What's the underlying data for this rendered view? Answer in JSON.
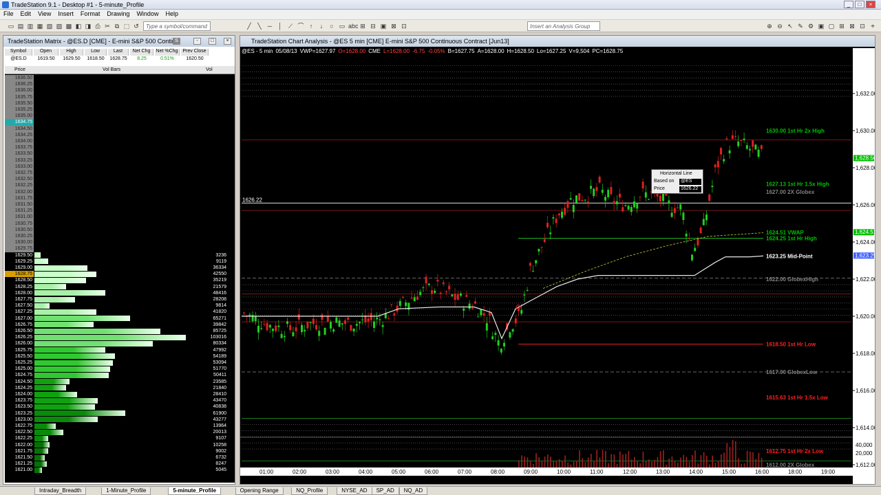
{
  "window": {
    "title": "TradeStation 9.1 - Desktop #1 - 5-minute_Profile"
  },
  "menu": [
    "File",
    "Edit",
    "View",
    "Insert",
    "Format",
    "Drawing",
    "Window",
    "Help"
  ],
  "toolbar": {
    "symbol_placeholder": "Type a symbol/command",
    "analysis_placeholder": "Insert an Analysis Group"
  },
  "matrix": {
    "title": "TradeStation Matrix - @ES.D [CME] - E-mini S&P 500 Contin...",
    "quote_headers": [
      "Symbol",
      "Open",
      "High",
      "Low",
      "Last",
      "Net Chg",
      "Net %Chg",
      "Prev Close"
    ],
    "quote_values": [
      "@ES.D",
      "1619.50",
      "1629.50",
      "1618.50",
      "1628.75",
      "8.25",
      "0.51%",
      "1620.50"
    ],
    "ladder_headers": {
      "price": "Price",
      "bars": "Vol Bars",
      "vol": "Vol"
    },
    "empty_prices": [
      "1636.50",
      "1636.25",
      "1636.00",
      "1635.75",
      "1635.50",
      "1635.25",
      "1635.00",
      "1634.75",
      "1634.50",
      "1634.25",
      "1634.00",
      "1633.75",
      "1633.50",
      "1633.25",
      "1633.00",
      "1632.75",
      "1632.50",
      "1632.25",
      "1632.00",
      "1631.75",
      "1631.50",
      "1631.25",
      "1631.00",
      "1630.75",
      "1630.50",
      "1630.25",
      "1630.00",
      "1629.75"
    ],
    "rows": [
      {
        "price": "1629.50",
        "vol": "3236",
        "vb": 0.04
      },
      {
        "price": "1629.25",
        "vol": "9119",
        "vb": 0.09
      },
      {
        "price": "1629.00",
        "vol": "36334",
        "vb": 0.35
      },
      {
        "price": "1628.75",
        "vol": "42550",
        "vb": 0.41,
        "last": true
      },
      {
        "price": "1628.50",
        "vol": "35219",
        "vb": 0.34
      },
      {
        "price": "1628.25",
        "vol": "21579",
        "vb": 0.21
      },
      {
        "price": "1628.00",
        "vol": "48416",
        "vb": 0.47
      },
      {
        "price": "1627.75",
        "vol": "28208",
        "vb": 0.27
      },
      {
        "price": "1627.50",
        "vol": "9814",
        "vb": 0.1
      },
      {
        "price": "1627.25",
        "vol": "41820",
        "vb": 0.41
      },
      {
        "price": "1627.00",
        "vol": "65271",
        "vb": 0.63
      },
      {
        "price": "1626.75",
        "vol": "39842",
        "vb": 0.39
      },
      {
        "price": "1626.50",
        "vol": "85725",
        "vb": 0.83
      },
      {
        "price": "1626.25",
        "vol": "103016",
        "vb": 1.0
      },
      {
        "price": "1626.00",
        "vol": "80334",
        "vb": 0.78
      },
      {
        "price": "1625.75",
        "vol": "47992",
        "vb": 0.47
      },
      {
        "price": "1625.50",
        "vol": "54189",
        "vb": 0.53
      },
      {
        "price": "1625.25",
        "vol": "53094",
        "vb": 0.52
      },
      {
        "price": "1625.00",
        "vol": "51770",
        "vb": 0.5
      },
      {
        "price": "1624.75",
        "vol": "50411",
        "vb": 0.49
      },
      {
        "price": "1624.50",
        "vol": "23585",
        "vb": 0.23
      },
      {
        "price": "1624.25",
        "vol": "21840",
        "vb": 0.21
      },
      {
        "price": "1624.00",
        "vol": "28410",
        "vb": 0.28
      },
      {
        "price": "1623.75",
        "vol": "43470",
        "vb": 0.42
      },
      {
        "price": "1623.50",
        "vol": "40838",
        "vb": 0.4
      },
      {
        "price": "1623.25",
        "vol": "61900",
        "vb": 0.6
      },
      {
        "price": "1623.00",
        "vol": "43277",
        "vb": 0.42
      },
      {
        "price": "1622.75",
        "vol": "13964",
        "vb": 0.14
      },
      {
        "price": "1622.50",
        "vol": "20013",
        "vb": 0.19
      },
      {
        "price": "1622.25",
        "vol": "9107",
        "vb": 0.09
      },
      {
        "price": "1622.00",
        "vol": "10258",
        "vb": 0.1
      },
      {
        "price": "1621.75",
        "vol": "9002",
        "vb": 0.09
      },
      {
        "price": "1621.50",
        "vol": "6732",
        "vb": 0.07
      },
      {
        "price": "1621.25",
        "vol": "8247",
        "vb": 0.08
      },
      {
        "price": "1621.00",
        "vol": "5045",
        "vb": 0.05
      }
    ]
  },
  "chart": {
    "title": "TradeStation Chart Analysis - @ES 5 min [CME] E-mini S&P 500 Continuous Contract [Jun13]",
    "info": [
      "@ES - 5 min",
      "05/08/13",
      "VWP=1627.97",
      "O=1628.00",
      "CME",
      "L=1628.00",
      "-6.75",
      "-0.05%",
      "B=1627.75",
      "A=1628.00",
      "H=1628.50",
      "Lo=1627.25",
      "V=9,504",
      "PC=1628.75"
    ],
    "hline_label": "1626.22",
    "price_labels": [
      "1,632.00",
      "1,630.00",
      "1,628.00",
      "1,626.00",
      "1,624.00",
      "1,622.00",
      "1,620.00",
      "1,618.00",
      "1,616.00",
      "1,614.00",
      "1,612.00"
    ],
    "price_ticks": [
      1632,
      1630,
      1628,
      1626,
      1624,
      1622,
      1620,
      1618,
      1616,
      1614,
      1612
    ],
    "vol_labels": [
      "40,000",
      "20,000"
    ],
    "time_labels": [
      "01:00",
      "02:00",
      "03:00",
      "04:00",
      "05:00",
      "06:00",
      "07:00",
      "08:00",
      "09:00",
      "10:00",
      "11:00",
      "12:00",
      "13:00",
      "14:00",
      "15:00",
      "16:00",
      "18:00",
      "19:00"
    ],
    "right_tags": [
      {
        "text": "1,628.50",
        "price": 1628.5,
        "color": "#00c000"
      },
      {
        "text": "1,624.51",
        "price": 1624.51,
        "color": "#00c000"
      },
      {
        "text": "1,623.25",
        "price": 1623.25,
        "color": "#4060ff"
      }
    ],
    "levels": [
      {
        "text": "1630.00 1st Hr  2x High",
        "price": 1630.0,
        "color": "#00c000"
      },
      {
        "text": "1627.13 1st Hr  1.5x High",
        "price": 1627.13,
        "color": "#00c000"
      },
      {
        "text": "1627.00 2X Globex",
        "price": 1626.7,
        "color": "#808080"
      },
      {
        "text": "1624.51 VWAP",
        "price": 1624.51,
        "color": "#00c000"
      },
      {
        "text": "1624.25 1st Hr  High",
        "price": 1624.2,
        "color": "#00c000"
      },
      {
        "text": "1623.25 Mid-Point",
        "price": 1623.25,
        "color": "#ffffff"
      },
      {
        "text": "1622.00 GlobexHigh",
        "price": 1622.0,
        "color": "#808080"
      },
      {
        "text": "1618.50 1st Hr  Low",
        "price": 1618.5,
        "color": "#ff2020"
      },
      {
        "text": "1617.00 GlobexLow",
        "price": 1617.0,
        "color": "#808080"
      },
      {
        "text": "1615.63 1st Hr  1.5x Low",
        "price": 1615.63,
        "color": "#ff2020"
      },
      {
        "text": "1612.75 1st Hr  2x Low",
        "price": 1612.75,
        "color": "#ff2020"
      },
      {
        "text": "1612.00 2X Globex",
        "price": 1612.0,
        "color": "#808080"
      }
    ],
    "tooltip": {
      "title": "Horizontal Line",
      "based_label": "Based on",
      "based_value": "@ES",
      "price_label": "Price",
      "price_value": "1626.22"
    }
  },
  "tabs": [
    "Intraday_Breadth",
    "1-Minute_Profile",
    "5-minute_Profile",
    "Opening Range",
    "NQ_Profile",
    "NYSE_AD",
    "SP_AD",
    "NQ_AD"
  ],
  "active_tab": "5-minute_Profile"
}
